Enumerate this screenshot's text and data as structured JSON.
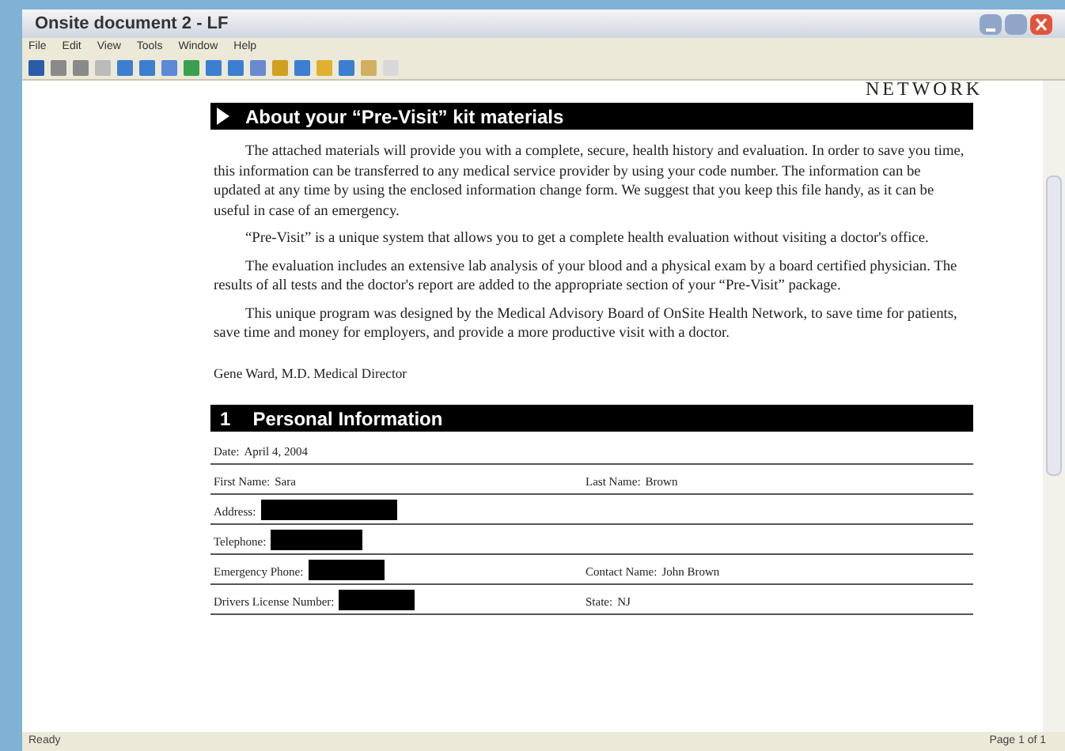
{
  "window": {
    "title": "Onsite document 2 - LF"
  },
  "menu": [
    "File",
    "Edit",
    "View",
    "Tools",
    "Window",
    "Help"
  ],
  "document": {
    "logo_fragment": "NETWORK",
    "section_heading": "About your “Pre-Visit” kit materials",
    "paragraphs": [
      "The attached materials will provide you with a complete, secure, health history and evaluation. In order to save you time, this information can be transferred to any medical service provider by using your code number. The information can be updated at any time by using the enclosed information change form. We suggest that you keep this file handy, as it can be useful in case of an emergency.",
      "“Pre-Visit” is a unique system that allows you to get a complete health evaluation without visiting a doctor's office.",
      "The evaluation includes an extensive lab analysis of your blood and a physical exam by a board certified physician. The results of all tests and the doctor's report are added to the appropriate section of your “Pre-Visit” package.",
      "This unique program was designed by the Medical Advisory Board of OnSite Health Network, to save time for patients, save time and money for employers, and provide a more productive visit with a doctor."
    ],
    "signature": "Gene Ward, M.D. Medical Director",
    "form_heading_number": "1",
    "form_heading": "Personal Information",
    "form_rows": [
      [
        {
          "label": "Date:",
          "value": "April 4, 2004"
        }
      ],
      [
        {
          "label": "First Name:",
          "value": "Sara"
        },
        {
          "label": "Last Name:",
          "value": "Brown"
        }
      ],
      [
        {
          "label": "Address:",
          "redacted": true
        }
      ],
      [
        {
          "label": "Telephone:",
          "redacted": true
        }
      ],
      [
        {
          "label": "Emergency Phone:",
          "redacted": true
        },
        {
          "label": "Contact Name:",
          "value": "John Brown"
        }
      ],
      [
        {
          "label": "Drivers License Number:",
          "redacted": true
        },
        {
          "label": "State:",
          "value": "NJ"
        }
      ]
    ]
  },
  "status_bar": {
    "left": "Ready",
    "right": "Page 1 of 1"
  }
}
